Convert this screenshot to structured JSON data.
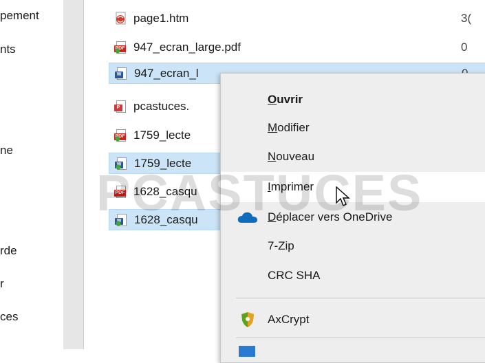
{
  "left_pane": {
    "items": [
      "pement",
      "nts",
      "ne",
      "rde",
      "r",
      "ces"
    ]
  },
  "files": [
    {
      "name": "page1.htm",
      "size": "3(",
      "icon": "html-file-icon",
      "selected": false
    },
    {
      "name": "947_ecran_large.pdf",
      "size": "0",
      "icon": "pdf-file-icon",
      "selected": false
    },
    {
      "name": "947_ecran_l",
      "size": "0",
      "icon": "word-file-icon",
      "selected": true
    },
    {
      "name": "pcastuces.",
      "size": "",
      "icon": "publisher-file-icon",
      "selected": false
    },
    {
      "name": "1759_lecte",
      "size": "",
      "icon": "pdf-file-icon",
      "selected": false
    },
    {
      "name": "1759_lecte",
      "size": "",
      "icon": "publisher-file-icon",
      "selected": true
    },
    {
      "name": "1628_casqu",
      "size": "",
      "icon": "pdf-file-icon",
      "selected": false
    },
    {
      "name": "1628_casqu",
      "size": "",
      "icon": "publisher-file-icon",
      "selected": true
    }
  ],
  "context_menu": {
    "items": [
      {
        "label": "Ouvrir",
        "bold": true,
        "underline": "O"
      },
      {
        "label": "Modifier",
        "underline": "M"
      },
      {
        "label": "Nouveau",
        "underline": "N"
      },
      {
        "label": "Imprimer",
        "underline": "I",
        "hover": true
      },
      {
        "label": "Déplacer vers OneDrive",
        "underline": "D",
        "icon": "onedrive-cloud-icon"
      },
      {
        "label": "7-Zip"
      },
      {
        "label": "CRC SHA"
      },
      {
        "label": "AxCrypt",
        "icon": "axcrypt-shield-icon"
      }
    ]
  },
  "watermark": {
    "text": "PCASTUCES"
  },
  "colors": {
    "selection": "#cce4f7",
    "menu_bg": "#eeeeee",
    "pdf_red": "#d0211c",
    "word_blue": "#2b579a",
    "onedrive_blue": "#0f6cbd",
    "axcrypt_green": "#5ba21f"
  }
}
